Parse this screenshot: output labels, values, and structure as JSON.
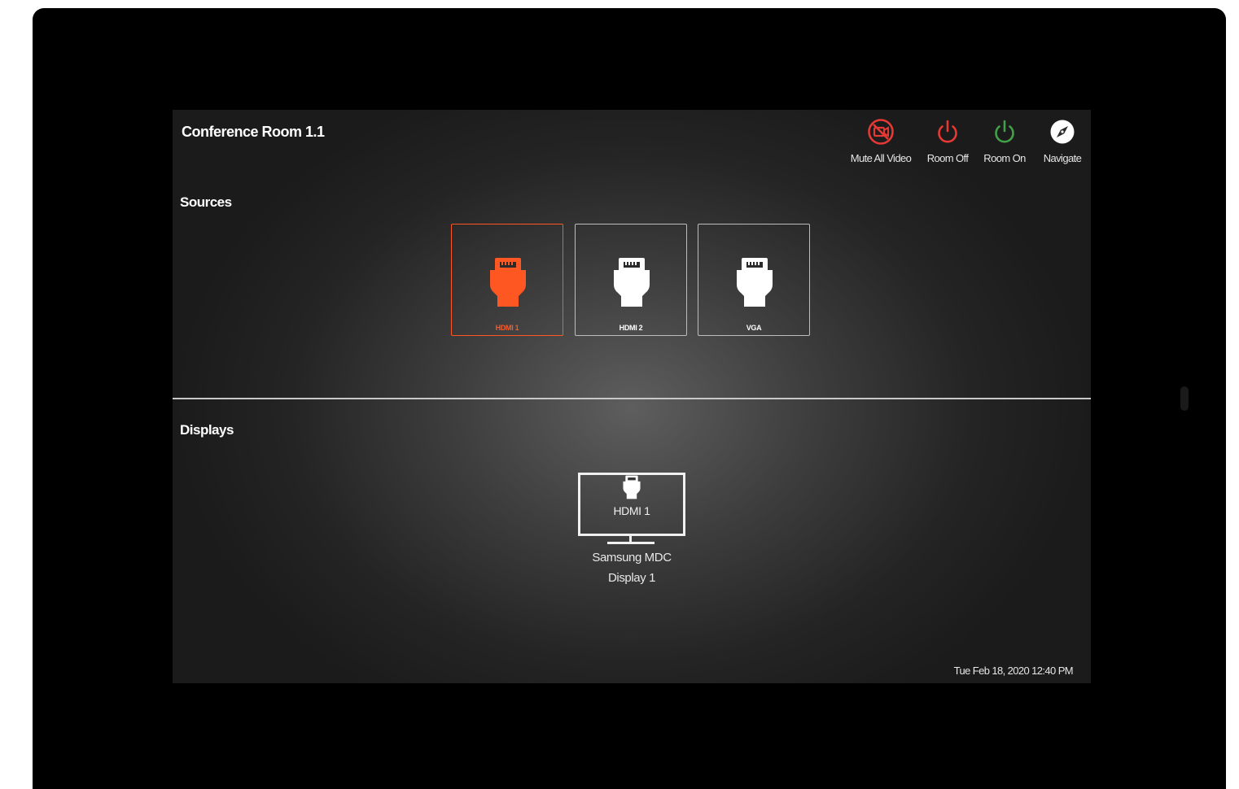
{
  "header": {
    "room_title": "Conference Room 1.1",
    "buttons": [
      {
        "label": "Mute All Video",
        "icon": "video-off-icon",
        "color": "#e53935"
      },
      {
        "label": "Room Off",
        "icon": "power-icon",
        "color": "#e53935"
      },
      {
        "label": "Room On",
        "icon": "power-icon",
        "color": "#43a047"
      },
      {
        "label": "Navigate",
        "icon": "compass-icon",
        "color": "#ffffff"
      }
    ]
  },
  "sources": {
    "heading": "Sources",
    "items": [
      {
        "label": "HDMI 1",
        "icon": "hdmi-plug-icon",
        "selected": true
      },
      {
        "label": "HDMI 2",
        "icon": "hdmi-plug-icon",
        "selected": false
      },
      {
        "label": "VGA",
        "icon": "hdmi-plug-icon",
        "selected": false
      }
    ]
  },
  "displays": {
    "heading": "Displays",
    "items": [
      {
        "current_input": "HDMI 1",
        "name_line1": "Samsung MDC",
        "name_line2": "Display 1"
      }
    ]
  },
  "status": {
    "datetime": "Tue Feb 18, 2020 12:40 PM"
  },
  "colors": {
    "accent": "#ff5722",
    "danger": "#e53935",
    "success": "#43a047"
  }
}
